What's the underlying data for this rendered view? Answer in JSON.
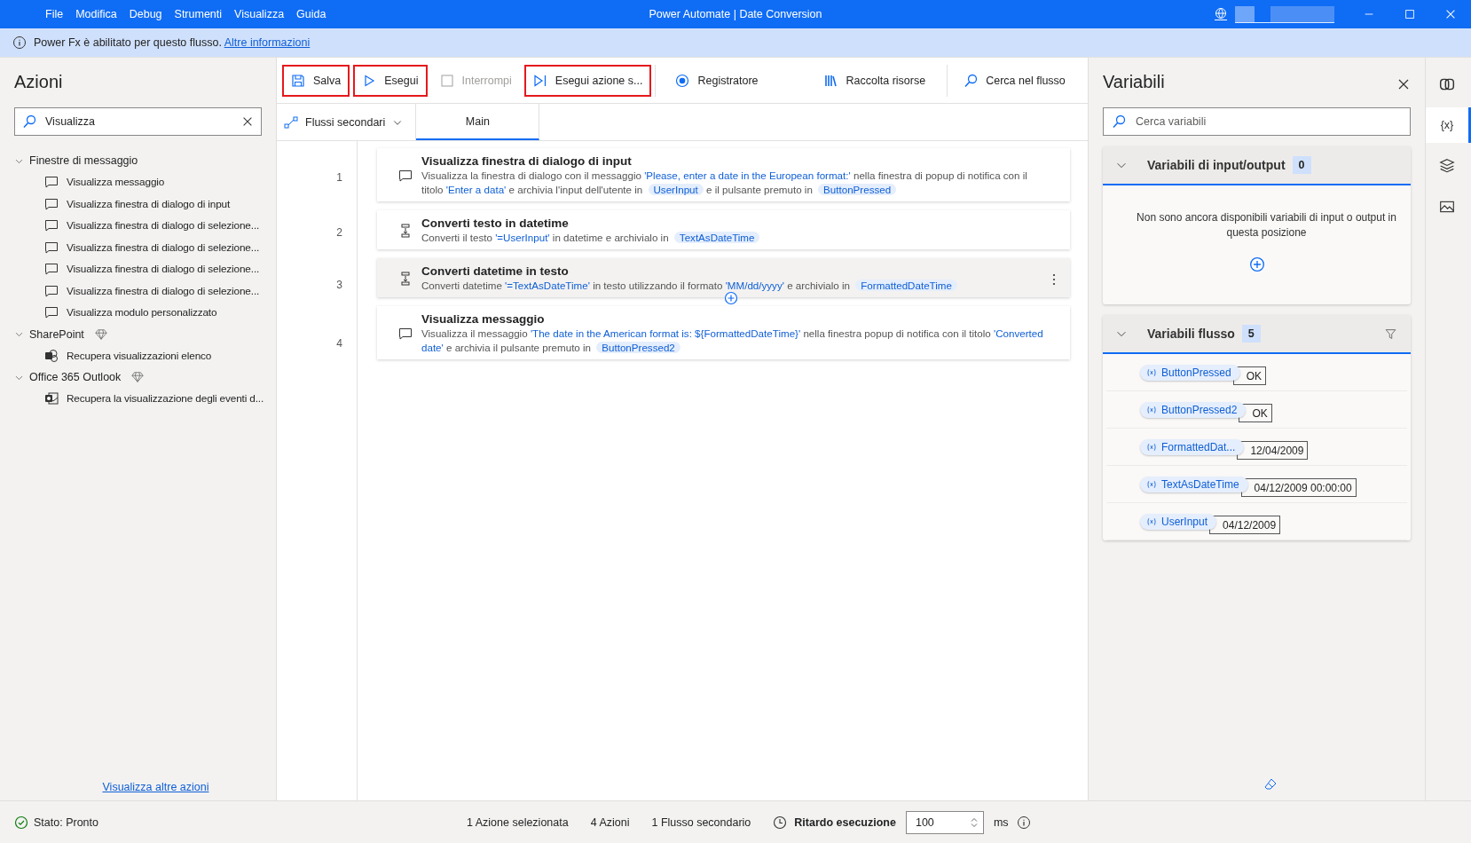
{
  "title_bar": {
    "menus": [
      "File",
      "Modifica",
      "Debug",
      "Strumenti",
      "Visualizza",
      "Guida"
    ],
    "title": "Power Automate | Date Conversion"
  },
  "info_bar": {
    "text": "Power Fx è abilitato per questo flusso.",
    "link": "Altre informazioni"
  },
  "actions_panel": {
    "title": "Azioni",
    "search": {
      "value": "Visualizza"
    },
    "groups": [
      {
        "label": "Finestre di messaggio",
        "expanded": true,
        "premium": false,
        "children": [
          {
            "label": "Visualizza messaggio",
            "kind": "message"
          },
          {
            "label": "Visualizza finestra di dialogo di input",
            "kind": "message"
          },
          {
            "label": "Visualizza finestra di dialogo di selezione...",
            "kind": "message"
          },
          {
            "label": "Visualizza finestra di dialogo di selezione...",
            "kind": "message"
          },
          {
            "label": "Visualizza finestra di dialogo di selezione...",
            "kind": "message"
          },
          {
            "label": "Visualizza finestra di dialogo di selezione...",
            "kind": "message"
          },
          {
            "label": "Visualizza modulo personalizzato",
            "kind": "message"
          }
        ]
      },
      {
        "label": "SharePoint",
        "expanded": true,
        "premium": true,
        "children": [
          {
            "label": "Recupera visualizzazioni elenco",
            "kind": "sharepoint"
          }
        ]
      },
      {
        "label": "Office 365 Outlook",
        "expanded": true,
        "premium": true,
        "children": [
          {
            "label": "Recupera la visualizzazione degli eventi d...",
            "kind": "outlook"
          }
        ]
      }
    ],
    "more_link": "Visualizza altre azioni"
  },
  "toolbar": {
    "groups": [
      {
        "items": [
          {
            "label": "Salva",
            "kind": "save",
            "highlighted": true,
            "disabled": false
          },
          {
            "label": "Esegui",
            "kind": "run",
            "highlighted": true,
            "disabled": false
          },
          {
            "label": "Interrompi",
            "kind": "stop",
            "highlighted": false,
            "disabled": true
          },
          {
            "label": "Esegui azione s...",
            "kind": "step",
            "highlighted": true,
            "disabled": false
          }
        ]
      },
      {
        "items": [
          {
            "label": "Registratore",
            "kind": "record",
            "highlighted": false,
            "disabled": false
          },
          {
            "label": "Raccolta risorse",
            "kind": "library",
            "highlighted": false,
            "disabled": false
          }
        ]
      },
      {
        "items": [
          {
            "label": "Cerca nel flusso",
            "kind": "search",
            "highlighted": false,
            "disabled": false
          }
        ]
      }
    ]
  },
  "subflows": {
    "label": "Flussi secondari"
  },
  "tabs": [
    {
      "label": "Main",
      "selected": true
    }
  ],
  "steps": [
    {
      "number": "1",
      "kind": "message",
      "title": "Visualizza finestra di dialogo di input",
      "selected": false,
      "description": [
        {
          "kind": "text",
          "text": "Visualizza la finestra di dialogo con il messaggio "
        },
        {
          "kind": "literal",
          "text": "'Please, enter a date in the European format:'"
        },
        {
          "kind": "text",
          "text": " nella finestra di popup di notifica con il titolo "
        },
        {
          "kind": "literal",
          "text": "'Enter a data'"
        },
        {
          "kind": "text",
          "text": " e archivia l'input dell'utente in "
        },
        {
          "kind": "var",
          "text": "UserInput"
        },
        {
          "kind": "text",
          "text": " e il pulsante premuto in "
        },
        {
          "kind": "var",
          "text": "ButtonPressed"
        }
      ]
    },
    {
      "number": "2",
      "kind": "convert",
      "title": "Converti testo in datetime",
      "selected": false,
      "description": [
        {
          "kind": "text",
          "text": "Converti il testo "
        },
        {
          "kind": "literal",
          "text": "'=UserInput'"
        },
        {
          "kind": "text",
          "text": " in datetime e archivialo in "
        },
        {
          "kind": "var",
          "text": "TextAsDateTime"
        }
      ]
    },
    {
      "number": "3",
      "kind": "convert",
      "title": "Converti datetime in testo",
      "selected": true,
      "description": [
        {
          "kind": "text",
          "text": "Converti datetime "
        },
        {
          "kind": "literal",
          "text": "'=TextAsDateTime'"
        },
        {
          "kind": "text",
          "text": " in testo utilizzando il formato "
        },
        {
          "kind": "literal",
          "text": "'MM/dd/yyyy'"
        },
        {
          "kind": "text",
          "text": " e archivialo in "
        },
        {
          "kind": "var",
          "text": "FormattedDateTime"
        }
      ]
    },
    {
      "number": "4",
      "kind": "message",
      "title": "Visualizza messaggio",
      "selected": false,
      "description": [
        {
          "kind": "text",
          "text": "Visualizza il messaggio "
        },
        {
          "kind": "literal",
          "text": "'The date in the American format is: ${FormattedDateTime}'"
        },
        {
          "kind": "text",
          "text": " nella finestra popup di notifica con il titolo "
        },
        {
          "kind": "literal",
          "text": "'Converted date'"
        },
        {
          "kind": "text",
          "text": " e archivia il pulsante premuto in "
        },
        {
          "kind": "var",
          "text": "ButtonPressed2"
        }
      ]
    }
  ],
  "variables_panel": {
    "title": "Variabili",
    "search": {
      "placeholder": "Cerca variabili"
    },
    "sections": [
      {
        "kind": "io",
        "title": "Variabili di input/output",
        "count": "0",
        "expanded": true,
        "empty_text": "Non sono ancora disponibili variabili di input o output in questa posizione"
      },
      {
        "kind": "flow",
        "title": "Variabili flusso",
        "count": "5",
        "expanded": true,
        "variables": [
          {
            "name": "ButtonPressed",
            "value": "OK"
          },
          {
            "name": "ButtonPressed2",
            "value": "OK"
          },
          {
            "name": "FormattedDat...",
            "value": "12/04/2009"
          },
          {
            "name": "TextAsDateTime",
            "value": "04/12/2009 00:00:00"
          },
          {
            "name": "UserInput",
            "value": "04/12/2009"
          }
        ]
      }
    ]
  },
  "side_rail": [
    {
      "kind": "copilot",
      "selected": false
    },
    {
      "kind": "variables",
      "label": "{x}",
      "selected": true
    },
    {
      "kind": "layers",
      "selected": false
    },
    {
      "kind": "image",
      "selected": false
    }
  ],
  "status_bar": {
    "status": "Stato: Pronto",
    "counts": [
      "1 Azione selezionata",
      "4 Azioni",
      "1 Flusso secondario"
    ],
    "delay_label": "Ritardo esecuzione",
    "delay_value": "100",
    "unit": "ms"
  }
}
